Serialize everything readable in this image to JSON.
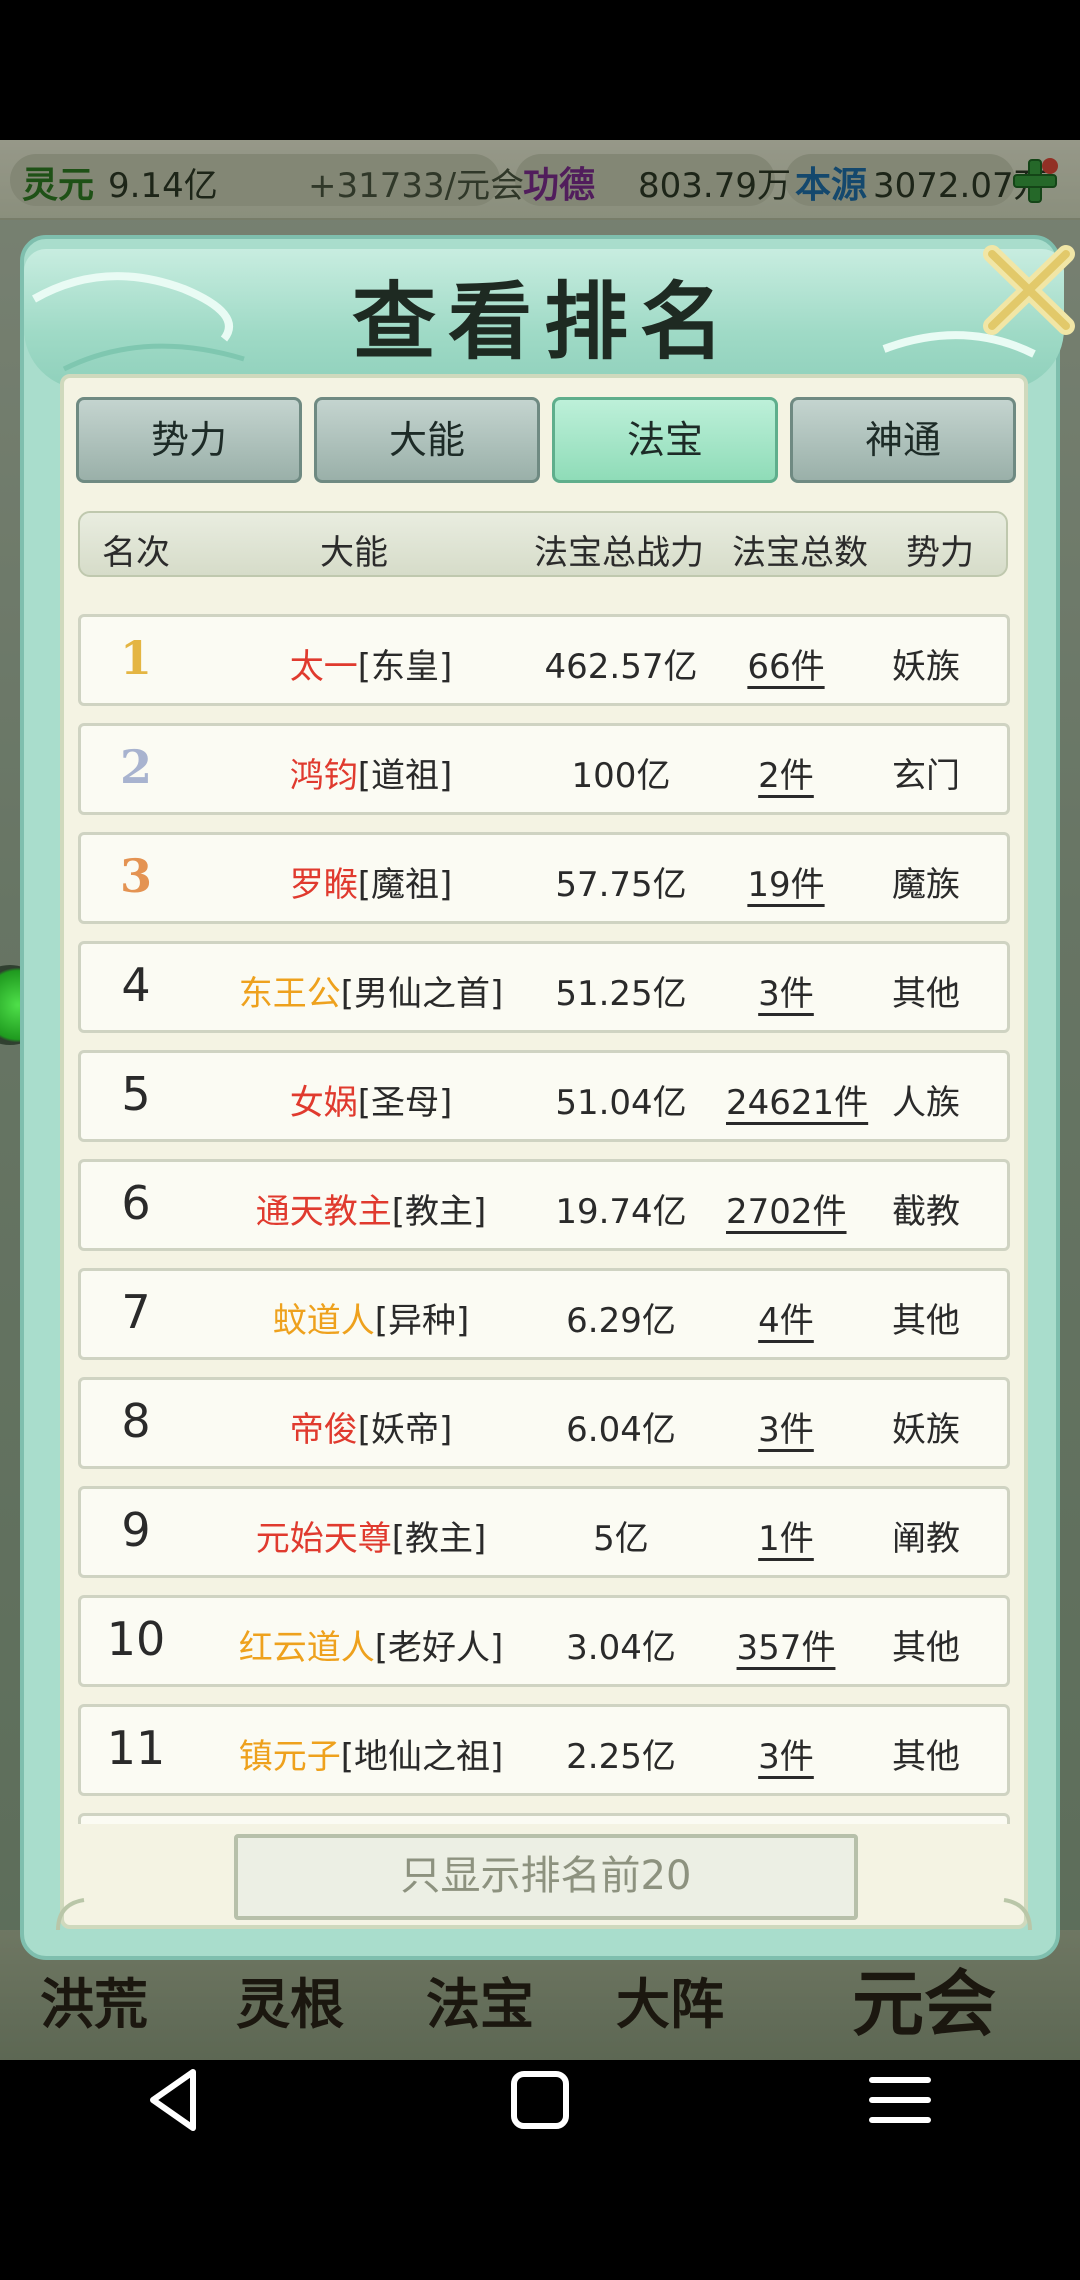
{
  "resources": {
    "lingyuan_label": "灵元",
    "lingyuan_value": "9.14亿",
    "rate": "+31733/元会",
    "gongde_label": "功德",
    "gongde_value": "803.79万",
    "benyuan_label": "本源",
    "benyuan_value": "3072.07万"
  },
  "bottom_menu": [
    "洪荒",
    "灵根",
    "法宝",
    "大阵",
    "元会"
  ],
  "dialog": {
    "title": "查看排名",
    "tabs": [
      {
        "label": "势力",
        "active": false
      },
      {
        "label": "大能",
        "active": false
      },
      {
        "label": "法宝",
        "active": true
      },
      {
        "label": "神通",
        "active": false
      }
    ],
    "columns": {
      "rank": "名次",
      "name": "大能",
      "power": "法宝总战力",
      "count": "法宝总数",
      "faction": "势力"
    },
    "rows": [
      {
        "rank": "1",
        "name": "太一",
        "title": "[东皇]",
        "power": "462.57亿",
        "count": "66件",
        "faction": "妖族",
        "name_color": "red",
        "medal": "gold"
      },
      {
        "rank": "2",
        "name": "鸿钧",
        "title": "[道祖]",
        "power": "100亿",
        "count": "2件",
        "faction": "玄门",
        "name_color": "red",
        "medal": "silver"
      },
      {
        "rank": "3",
        "name": "罗睺",
        "title": "[魔祖]",
        "power": "57.75亿",
        "count": "19件",
        "faction": "魔族",
        "name_color": "red",
        "medal": "bronze"
      },
      {
        "rank": "4",
        "name": "东王公",
        "title": "[男仙之首]",
        "power": "51.25亿",
        "count": "3件",
        "faction": "其他",
        "name_color": "orange",
        "medal": ""
      },
      {
        "rank": "5",
        "name": "女娲",
        "title": "[圣母]",
        "power": "51.04亿",
        "count": "24621件",
        "faction": "人族",
        "name_color": "red",
        "medal": ""
      },
      {
        "rank": "6",
        "name": "通天教主",
        "title": "[教主]",
        "power": "19.74亿",
        "count": "2702件",
        "faction": "截教",
        "name_color": "red",
        "medal": ""
      },
      {
        "rank": "7",
        "name": "蚊道人",
        "title": "[异种]",
        "power": "6.29亿",
        "count": "4件",
        "faction": "其他",
        "name_color": "orange",
        "medal": ""
      },
      {
        "rank": "8",
        "name": "帝俊",
        "title": "[妖帝]",
        "power": "6.04亿",
        "count": "3件",
        "faction": "妖族",
        "name_color": "red",
        "medal": ""
      },
      {
        "rank": "9",
        "name": "元始天尊",
        "title": "[教主]",
        "power": "5亿",
        "count": "1件",
        "faction": "阐教",
        "name_color": "red",
        "medal": ""
      },
      {
        "rank": "10",
        "name": "红云道人",
        "title": "[老好人]",
        "power": "3.04亿",
        "count": "357件",
        "faction": "其他",
        "name_color": "orange",
        "medal": ""
      },
      {
        "rank": "11",
        "name": "镇元子",
        "title": "[地仙之祖]",
        "power": "2.25亿",
        "count": "3件",
        "faction": "其他",
        "name_color": "orange",
        "medal": ""
      }
    ],
    "show_top_button": "只显示排名前20"
  },
  "icons": {
    "close": "close-x-icon",
    "add": "plus-icon",
    "nav_back": "back-icon",
    "nav_home": "home-icon",
    "nav_menu": "menu-icon"
  },
  "colors": {
    "name_red": "#e03a2e",
    "name_orange": "#eea11d",
    "gold": "#e4b542",
    "silver": "#a8b3cf",
    "bronze": "#e49352",
    "dialog_teal": "#a9ddcc"
  }
}
